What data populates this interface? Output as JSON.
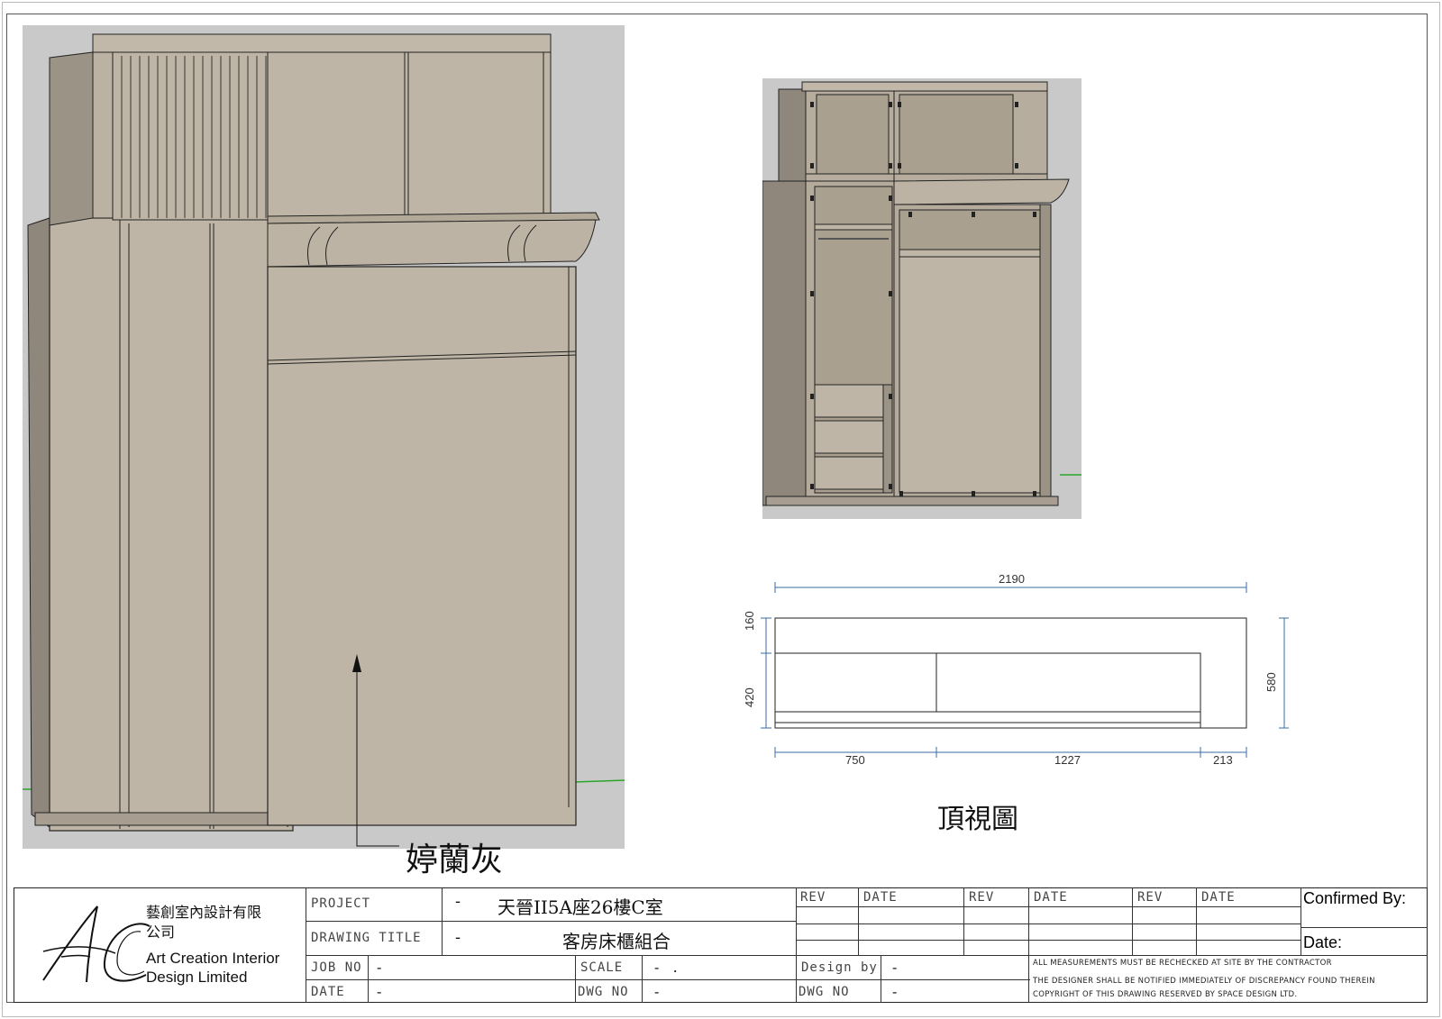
{
  "annotations": {
    "finish_label": "婷蘭灰",
    "top_view_label": "頂視圖"
  },
  "top_view_dims": {
    "overall_width": "2190",
    "depth_top": "160",
    "depth_mid": "420",
    "overall_depth": "580",
    "seg_left": "750",
    "seg_mid": "1227",
    "seg_right": "213"
  },
  "company": {
    "name_cn_line1": "藝創室內設計有限",
    "name_cn_line2": "公司",
    "name_en_line1": "Art Creation Interior",
    "name_en_line2": "Design Limited",
    "logo_text": "AC"
  },
  "title_block": {
    "project_label": "PROJECT",
    "project_dash": "-",
    "project_value": "天晉II5A座26樓C室",
    "drawing_title_label": "DRAWING TITLE",
    "drawing_title_dash": "-",
    "drawing_title_value": "客房床櫃組合",
    "job_no_label": "JOB NO",
    "job_no_value": "-",
    "date_label": "DATE",
    "date_value": "-",
    "scale_label": "SCALE",
    "scale_value": "-   .",
    "dwg_no_label": "DWG NO",
    "dwg_no_value": "-",
    "design_by_label": "Design by",
    "design_by_value": "-",
    "dwg_no2_label": "DWG NO",
    "dwg_no2_value": "-",
    "rev_headers": [
      "REV",
      "DATE",
      "REV",
      "DATE",
      "REV",
      "DATE"
    ],
    "confirmed_by": "Confirmed By:",
    "date_sign": "Date:",
    "notes": [
      "ALL MEASUREMENTS MUST BE RECHECKED AT SITE BY THE CONTRACTOR",
      "THE DESIGNER SHALL BE NOTIFIED IMMEDIATELY OF DISCREPANCY FOUND THEREIN",
      "COPYRIGHT OF THIS DRAWING RESERVED BY SPACE DESIGN LTD."
    ]
  }
}
